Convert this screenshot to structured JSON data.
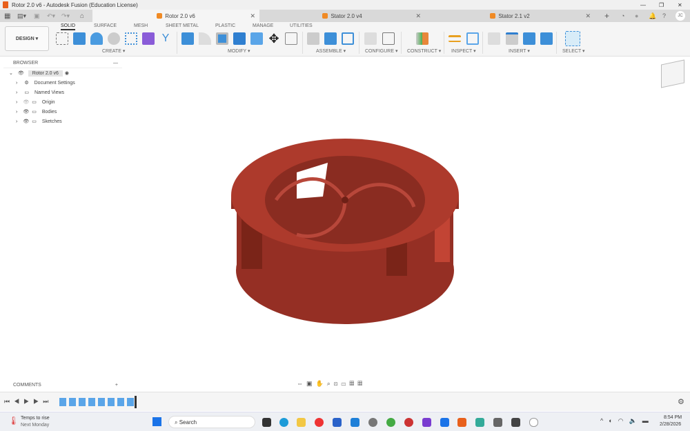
{
  "window": {
    "title": "Rotor 2.0 v6 - Autodesk Fusion (Education License)",
    "minimize": "—",
    "maximize": "❐",
    "close": "✕"
  },
  "tabs": [
    {
      "label": "Rotor 2.0 v6",
      "active": true
    },
    {
      "label": "Stator 2.0 v4"
    },
    {
      "label": "Stator 2.1 v2"
    }
  ],
  "user_initials": "JC",
  "toolbar": {
    "workspace": "DESIGN ▾",
    "workspace_tabs": [
      "SOLID",
      "SURFACE",
      "MESH",
      "SHEET METAL",
      "PLASTIC",
      "MANAGE",
      "UTILITIES"
    ],
    "groups": [
      "CREATE ▾",
      "MODIFY ▾",
      "ASSEMBLE ▾",
      "CONFIGURE ▾",
      "CONSTRUCT ▾",
      "INSPECT ▾",
      "INSERT ▾",
      "SELECT ▾"
    ]
  },
  "browser": {
    "title": "BROWSER",
    "root": "Rotor 2.0 v6",
    "items": [
      "Document Settings",
      "Named Views",
      "Origin",
      "Bodies",
      "Sketches"
    ]
  },
  "comments": {
    "label": "COMMENTS",
    "add": "+"
  },
  "model": {
    "color": "#a83a2c"
  },
  "taskbar": {
    "weather_title": "Temps to rise",
    "weather_sub": "Next Monday",
    "search_placeholder": "Search",
    "time": "8:54 PM",
    "date": "2/28/2026"
  }
}
